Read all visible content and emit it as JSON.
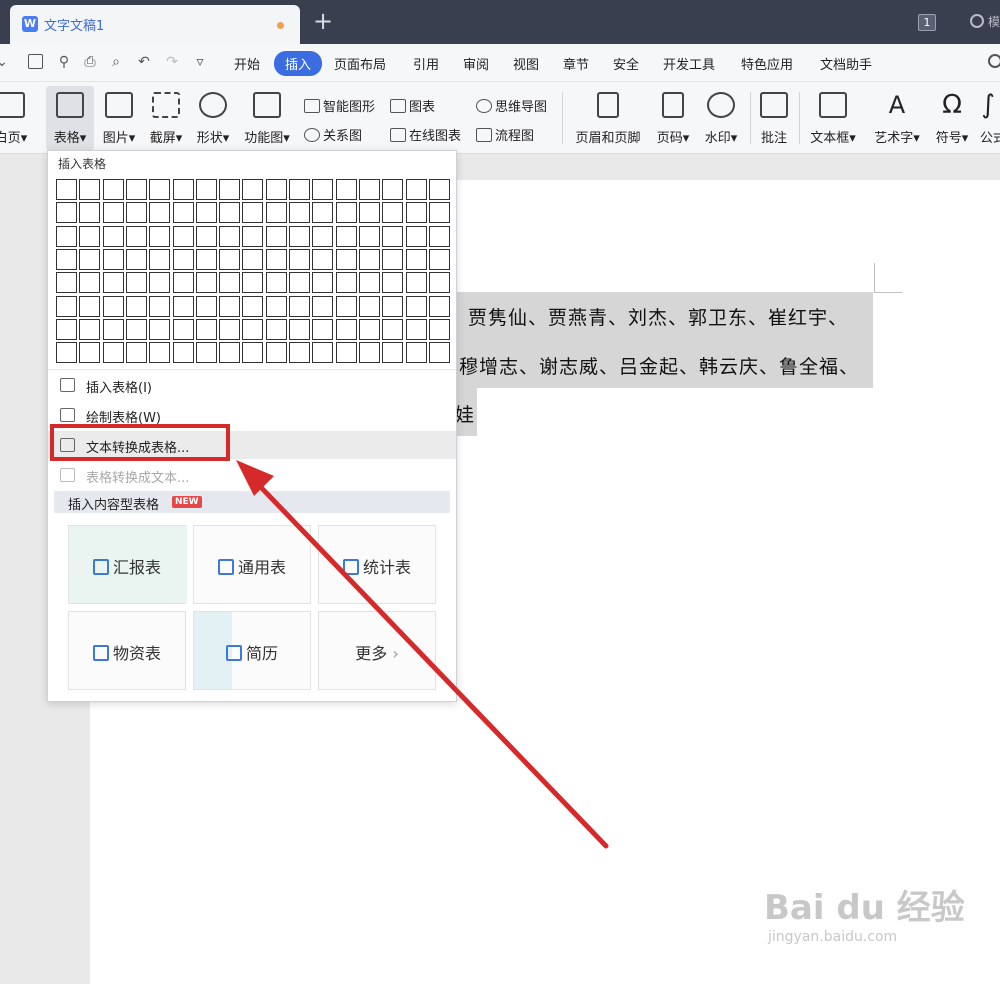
{
  "title_bar": {
    "tab_logo": "W",
    "tab_title": "文字文稿1",
    "new_tab": "+",
    "badge": "1",
    "right_label": "模"
  },
  "menu": {
    "tabs": [
      "开始",
      "插入",
      "页面布局",
      "引用",
      "审阅",
      "视图",
      "章节",
      "安全",
      "开发工具",
      "特色应用",
      "文档助手"
    ],
    "active_tab": "插入"
  },
  "ribbon": {
    "page_label": "白页",
    "table_label": "表格",
    "picture_label": "图片",
    "screenshot_label": "截屏",
    "shape_label": "形状",
    "function_label": "功能图",
    "smart_shape": "智能图形",
    "chart": "图表",
    "mindmap": "思维导图",
    "relation": "关系图",
    "online_chart": "在线图表",
    "flowchart": "流程图",
    "header_footer": "页眉和页脚",
    "page_number": "页码",
    "watermark": "水印",
    "comment": "批注",
    "textbox": "文本框",
    "wordart": "艺术字",
    "symbol": "符号",
    "formula": "公式"
  },
  "dropdown": {
    "header": "插入表格",
    "grid_cols": 17,
    "grid_rows": 8,
    "items": [
      {
        "label": "插入表格(I)",
        "enabled": true
      },
      {
        "label": "绘制表格(W)",
        "enabled": true
      },
      {
        "label": "文本转换成表格...",
        "enabled": true
      },
      {
        "label": "表格转换成文本...",
        "enabled": false
      }
    ],
    "section_title": "插入内容型表格",
    "new_badge": "NEW",
    "templates": [
      "汇报表",
      "通用表",
      "统计表",
      "物资表",
      "简历",
      "更多"
    ]
  },
  "document": {
    "lines": [
      "贾隽仙、贾燕青、刘杰、郭卫东、崔红宇、",
      "穆增志、谢志威、吕金起、韩云庆、鲁全福、",
      "娃"
    ]
  },
  "watermark": {
    "brand": "Bai du 经验",
    "url": "jingyan.baidu.com"
  },
  "colors": {
    "accent": "#3b6ce0",
    "title_bar": "#3a3f4f",
    "highlight": "#d62a2a"
  }
}
